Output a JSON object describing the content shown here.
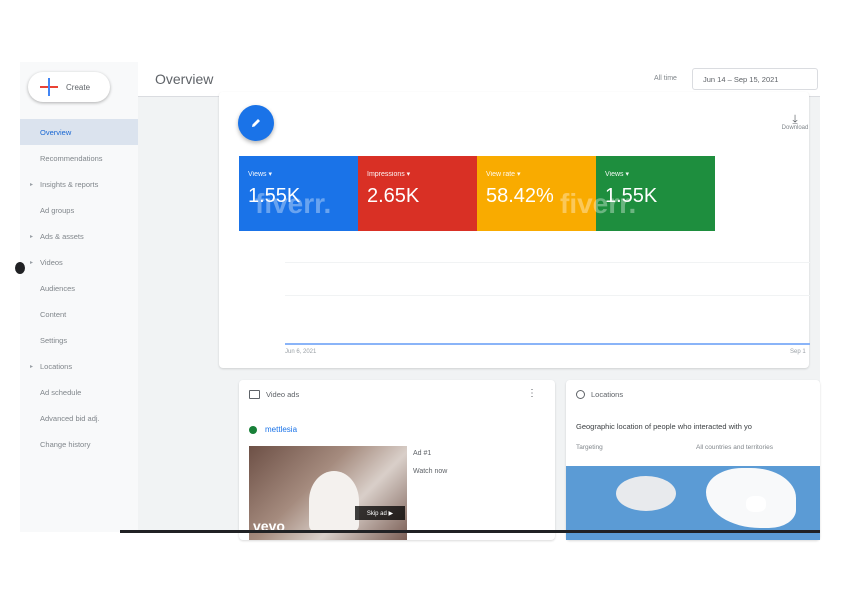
{
  "sidebar": {
    "create_label": "Create",
    "items": [
      {
        "label": "Overview",
        "selected": true,
        "expandable": false
      },
      {
        "label": "Recommendations",
        "selected": false,
        "expandable": false
      },
      {
        "label": "Insights & reports",
        "selected": false,
        "expandable": true
      },
      {
        "label": "Ad groups",
        "selected": false,
        "expandable": false
      },
      {
        "label": "Ads & assets",
        "selected": false,
        "expandable": true
      },
      {
        "label": "Videos",
        "selected": false,
        "expandable": true
      },
      {
        "label": "Audiences",
        "selected": false,
        "expandable": false
      },
      {
        "label": "Content",
        "selected": false,
        "expandable": false
      },
      {
        "label": "Settings",
        "selected": false,
        "expandable": false
      },
      {
        "label": "Locations",
        "selected": false,
        "expandable": true
      },
      {
        "label": "Ad schedule",
        "selected": false,
        "expandable": false
      },
      {
        "label": "Advanced bid adj.",
        "selected": false,
        "expandable": false
      },
      {
        "label": "Change history",
        "selected": false,
        "expandable": false
      }
    ]
  },
  "header": {
    "title": "Overview",
    "time_label": "All time",
    "date_range": "Jun 14 – Sep 15, 2021"
  },
  "toolbar": {
    "edit_icon": "pencil-icon",
    "download_label": "Download"
  },
  "metrics": [
    {
      "label": "Views ▾",
      "value": "1.55K",
      "color": "#1a73e8"
    },
    {
      "label": "Impressions ▾",
      "value": "2.65K",
      "color": "#d93025"
    },
    {
      "label": "View rate ▾",
      "value": "58.42%",
      "color": "#f9ab00"
    },
    {
      "label": "Views ▾",
      "value": "1.55K",
      "color": "#1e8e3e"
    }
  ],
  "chart": {
    "x_start": "Jun 6, 2021",
    "x_end": "Sep 1"
  },
  "video_ads": {
    "title": "Video ads",
    "channel": "mettlesia",
    "ad_number": "Ad #1",
    "cta": "Watch now",
    "thumb_logo": "vevo",
    "skip_label": "Skip ad ▶"
  },
  "locations": {
    "title": "Locations",
    "description": "Geographic location of people who interacted with yo",
    "targeting_label": "Targeting",
    "targeting_value": "All countries and territories"
  },
  "watermark": "fiverr."
}
